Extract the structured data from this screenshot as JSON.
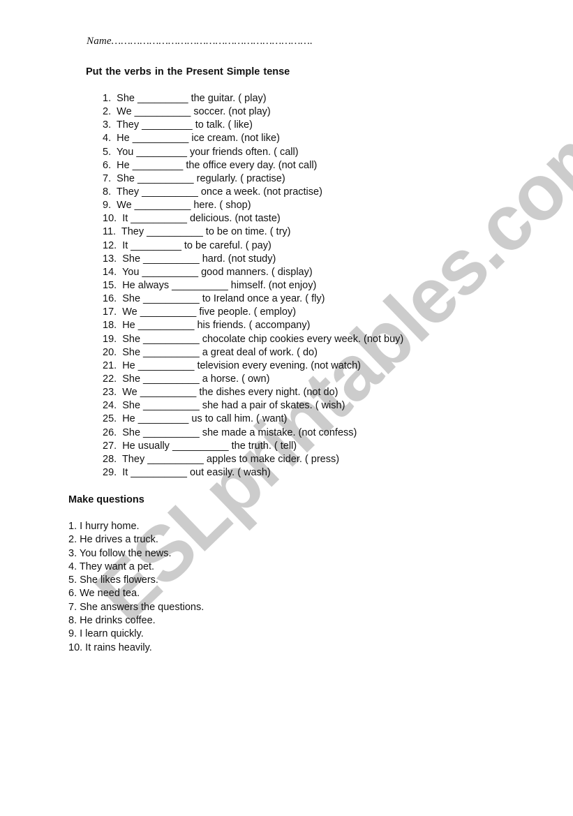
{
  "header": {
    "name_line": "Name………………………………………………………."
  },
  "section1": {
    "title": "Put the verbs in  the Present Simple tense",
    "items": [
      "1.  She _________ the guitar. ( play)",
      "2.  We __________ soccer. (not play)",
      "3.  They _________ to talk. ( like)",
      "4.  He __________ ice cream. (not like)",
      "5.  You _________ your friends often. ( call)",
      "6.  He _________ the office every day. (not call)",
      "7.  She __________ regularly. ( practise)",
      "8.  They __________ once a week. (not practise)",
      "9.  We __________ here. ( shop)",
      "10.  It __________ delicious. (not taste)",
      "11.  They __________ to be on time. ( try)",
      "12.  It _________ to be careful. ( pay)",
      "13.  She __________ hard. (not study)",
      "14.  You __________ good manners. ( display)",
      "15.  He always __________ himself. (not enjoy)",
      "16.  She __________ to Ireland once a year. ( fly)",
      "17.  We __________ five people. ( employ)",
      "18.  He __________ his friends. ( accompany)",
      "19.  She __________ chocolate chip cookies every week. (not buy)",
      "20.  She __________ a great deal of work. ( do)",
      "21.  He __________ television every evening. (not watch)",
      "22.  She __________ a horse. ( own)",
      "23.  We __________ the dishes every night. (not do)",
      "24.  She __________ she had a pair of skates. ( wish)",
      "25.  He _________ us to call him. ( want)",
      "26.  She __________ she made a mistake. (not confess)",
      "27.  He usually __________ the truth. ( tell)",
      "28.  They __________ apples to make cider. ( press)",
      "29.  It __________ out easily. ( wash)"
    ]
  },
  "section2": {
    "title": "Make questions",
    "items": [
      "1. I hurry home.",
      "2. He drives a truck.",
      "3. You follow the news.",
      "4. They want a pet.",
      "5. She likes flowers.",
      "6. We need tea.",
      "7. She answers the questions.",
      "8. He drinks coffee.",
      "9. I learn quickly.",
      "10. It rains heavily."
    ]
  },
  "watermark": "ESLprintables.com"
}
